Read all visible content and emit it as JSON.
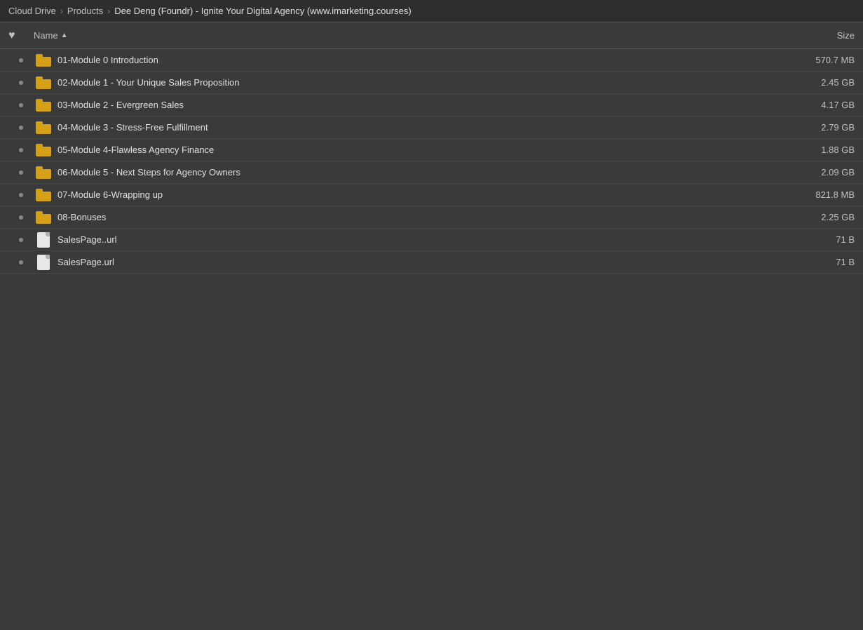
{
  "breadcrumb": {
    "root": "Cloud Drive",
    "parent": "Products",
    "current": "Dee Deng (Foundr) - Ignite Your Digital Agency (www.imarketing.courses)"
  },
  "table": {
    "headers": {
      "favorite": "",
      "name": "Name",
      "sort_arrow": "▲",
      "size": "Size"
    },
    "rows": [
      {
        "id": 1,
        "type": "folder",
        "name": "01-Module 0 Introduction",
        "size": "570.7 MB",
        "favorited": true
      },
      {
        "id": 2,
        "type": "folder",
        "name": "02-Module 1 - Your Unique Sales Proposition",
        "size": "2.45 GB",
        "favorited": true
      },
      {
        "id": 3,
        "type": "folder",
        "name": "03-Module 2 - Evergreen Sales",
        "size": "4.17 GB",
        "favorited": true
      },
      {
        "id": 4,
        "type": "folder",
        "name": "04-Module 3 - Stress-Free Fulfillment",
        "size": "2.79 GB",
        "favorited": true
      },
      {
        "id": 5,
        "type": "folder",
        "name": "05-Module 4-Flawless Agency Finance",
        "size": "1.88 GB",
        "favorited": true
      },
      {
        "id": 6,
        "type": "folder",
        "name": "06-Module 5 - Next Steps for Agency Owners",
        "size": "2.09 GB",
        "favorited": true
      },
      {
        "id": 7,
        "type": "folder",
        "name": "07-Module 6-Wrapping up",
        "size": "821.8 MB",
        "favorited": true
      },
      {
        "id": 8,
        "type": "folder",
        "name": "08-Bonuses",
        "size": "2.25 GB",
        "favorited": true
      },
      {
        "id": 9,
        "type": "file",
        "name": "SalesPage..url",
        "size": "71 B",
        "favorited": true
      },
      {
        "id": 10,
        "type": "file",
        "name": "SalesPage.url",
        "size": "71 B",
        "favorited": true
      }
    ]
  }
}
